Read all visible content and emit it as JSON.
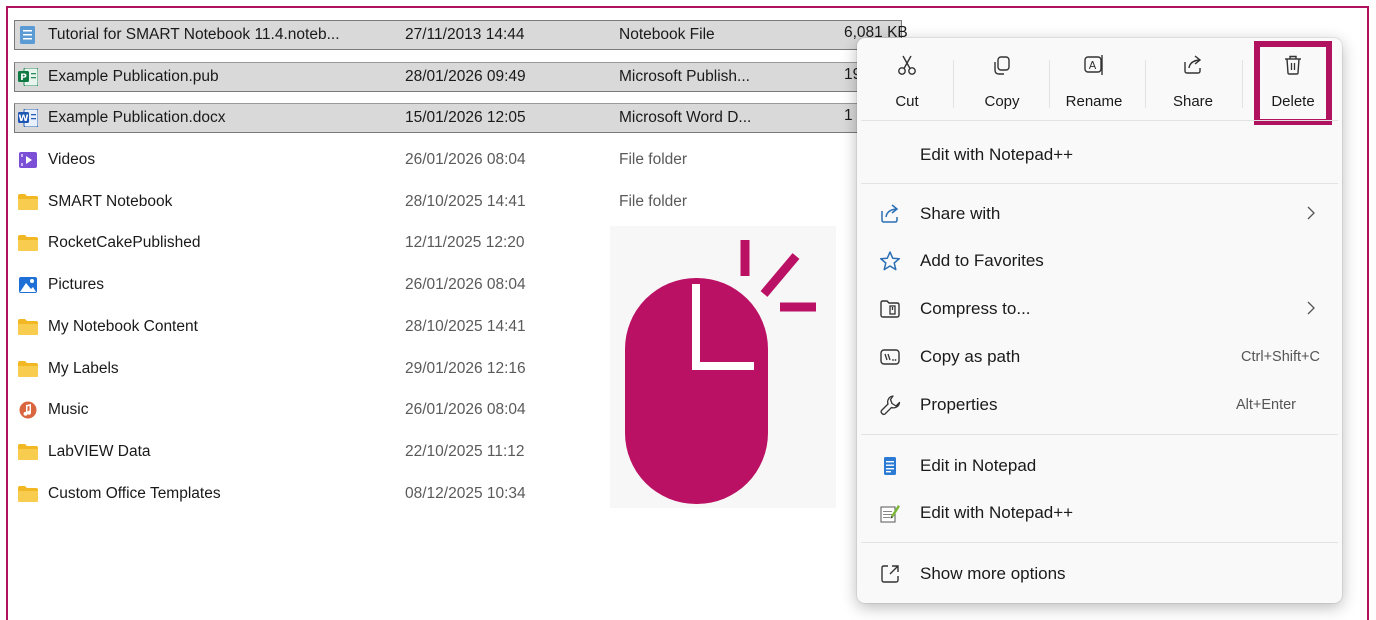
{
  "files": [
    {
      "name": "Tutorial for SMART Notebook 11.4.noteb...",
      "date": "27/11/2013 14:44",
      "type": "Notebook File",
      "size": "6,081 KB",
      "icon": "notebook-file-icon",
      "selected": true
    },
    {
      "name": "Example Publication.pub",
      "date": "28/01/2026 09:49",
      "type": "Microsoft Publish...",
      "size": "19",
      "icon": "publisher-file-icon",
      "selected": true
    },
    {
      "name": "Example Publication.docx",
      "date": "15/01/2026 12:05",
      "type": "Microsoft Word D...",
      "size": "1",
      "icon": "word-file-icon",
      "selected": true
    },
    {
      "name": "Videos",
      "date": "26/01/2026 08:04",
      "type": "File folder",
      "size": "",
      "icon": "videos-folder-icon",
      "selected": false
    },
    {
      "name": "SMART Notebook",
      "date": "28/10/2025 14:41",
      "type": "File folder",
      "size": "",
      "icon": "folder-icon",
      "selected": false
    },
    {
      "name": "RocketCakePublished",
      "date": "12/11/2025 12:20",
      "type": "",
      "size": "",
      "icon": "folder-icon",
      "selected": false
    },
    {
      "name": "Pictures",
      "date": "26/01/2026 08:04",
      "type": "",
      "size": "",
      "icon": "pictures-folder-icon",
      "selected": false
    },
    {
      "name": "My Notebook Content",
      "date": "28/10/2025 14:41",
      "type": "",
      "size": "",
      "icon": "folder-icon",
      "selected": false
    },
    {
      "name": "My Labels",
      "date": "29/01/2026 12:16",
      "type": "",
      "size": "",
      "icon": "folder-icon",
      "selected": false
    },
    {
      "name": "Music",
      "date": "26/01/2026 08:04",
      "type": "",
      "size": "",
      "icon": "music-folder-icon",
      "selected": false
    },
    {
      "name": "LabVIEW Data",
      "date": "22/10/2025 11:12",
      "type": "",
      "size": "",
      "icon": "folder-icon",
      "selected": false
    },
    {
      "name": "Custom Office Templates",
      "date": "08/12/2025 10:34",
      "type": "",
      "size": "",
      "icon": "folder-icon",
      "selected": false
    }
  ],
  "context_menu": {
    "quick_actions": [
      {
        "label": "Cut",
        "icon": "scissors-icon"
      },
      {
        "label": "Copy",
        "icon": "copy-icon"
      },
      {
        "label": "Rename",
        "icon": "rename-icon"
      },
      {
        "label": "Share",
        "icon": "share-icon"
      },
      {
        "label": "Delete",
        "icon": "trash-icon",
        "highlighted": true
      }
    ],
    "items": [
      {
        "label": "Edit with Notepad++",
        "icon": "",
        "shortcut": "",
        "submenu": false
      },
      {
        "label": "Share with",
        "icon": "share-with-icon",
        "shortcut": "",
        "submenu": true
      },
      {
        "label": "Add to Favorites",
        "icon": "star-icon",
        "shortcut": "",
        "submenu": false
      },
      {
        "label": "Compress to...",
        "icon": "archive-icon",
        "shortcut": "",
        "submenu": true
      },
      {
        "label": "Copy as path",
        "icon": "copy-path-icon",
        "shortcut": "Ctrl+Shift+C",
        "submenu": false
      },
      {
        "label": "Properties",
        "icon": "wrench-icon",
        "shortcut": "Alt+Enter",
        "submenu": false
      },
      {
        "label": "Edit in Notepad",
        "icon": "notepad-icon",
        "shortcut": "",
        "submenu": false
      },
      {
        "label": "Edit with Notepad++",
        "icon": "notepadpp-icon",
        "shortcut": "",
        "submenu": false
      },
      {
        "label": "Show more options",
        "icon": "expand-icon",
        "shortcut": "",
        "submenu": false
      }
    ]
  },
  "colors": {
    "accent": "#b0125f",
    "selection_bg": "#d9d9d9",
    "folder_yellow": "#f5c242"
  },
  "illustration": {
    "icon": "mouse-click-icon"
  }
}
